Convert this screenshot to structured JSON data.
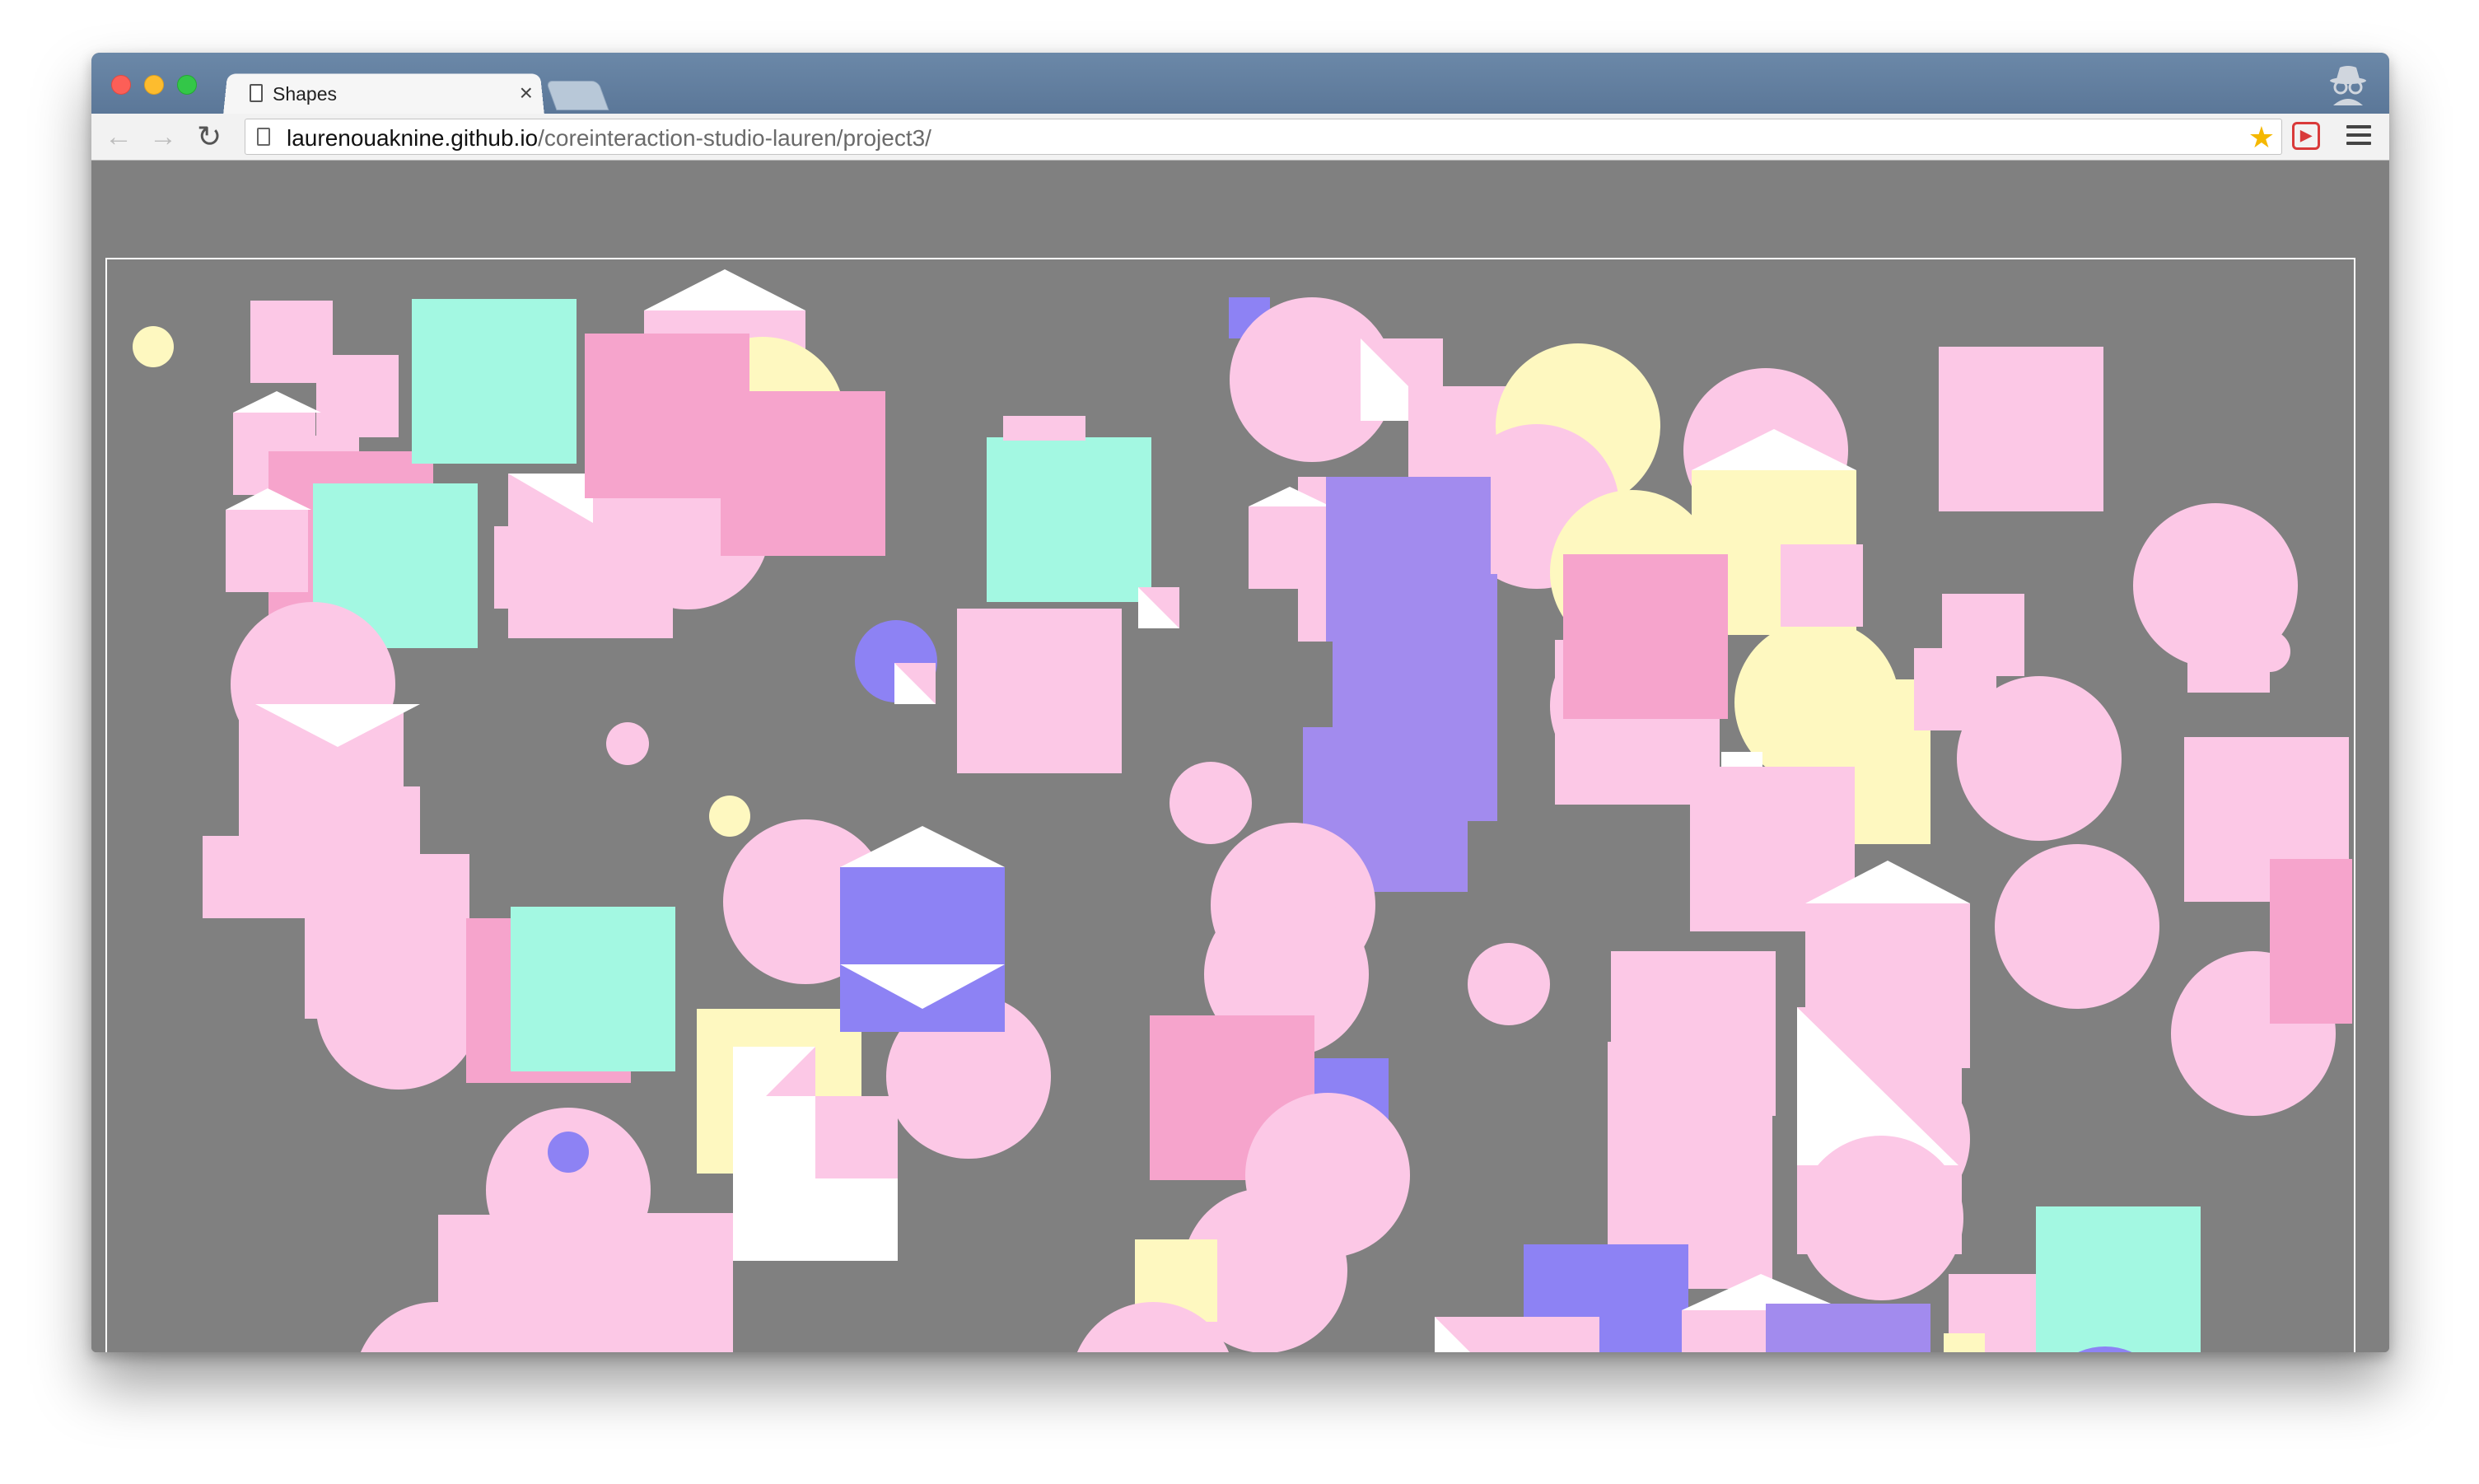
{
  "browser": {
    "tab_title": "Shapes",
    "tab_close": "×",
    "url_host": "laurenouaknine.github.io",
    "url_path": "/coreinteraction-studio-lauren/project3/",
    "icons": {
      "back": "back-arrow-icon",
      "forward": "forward-arrow-icon",
      "reload": "reload-icon",
      "star": "bookmark-star-icon",
      "extension": "extension-icon",
      "menu": "hamburger-menu-icon",
      "incognito": "incognito-icon"
    }
  },
  "palette": {
    "pink": "#fcc8e6",
    "hotpink": "#f6a4cc",
    "mint": "#a3f8e2",
    "yellow": "#fef8c0",
    "violet": "#8d82f4",
    "lavender": "#a28bee",
    "white": "#ffffff",
    "background": "#808080"
  }
}
